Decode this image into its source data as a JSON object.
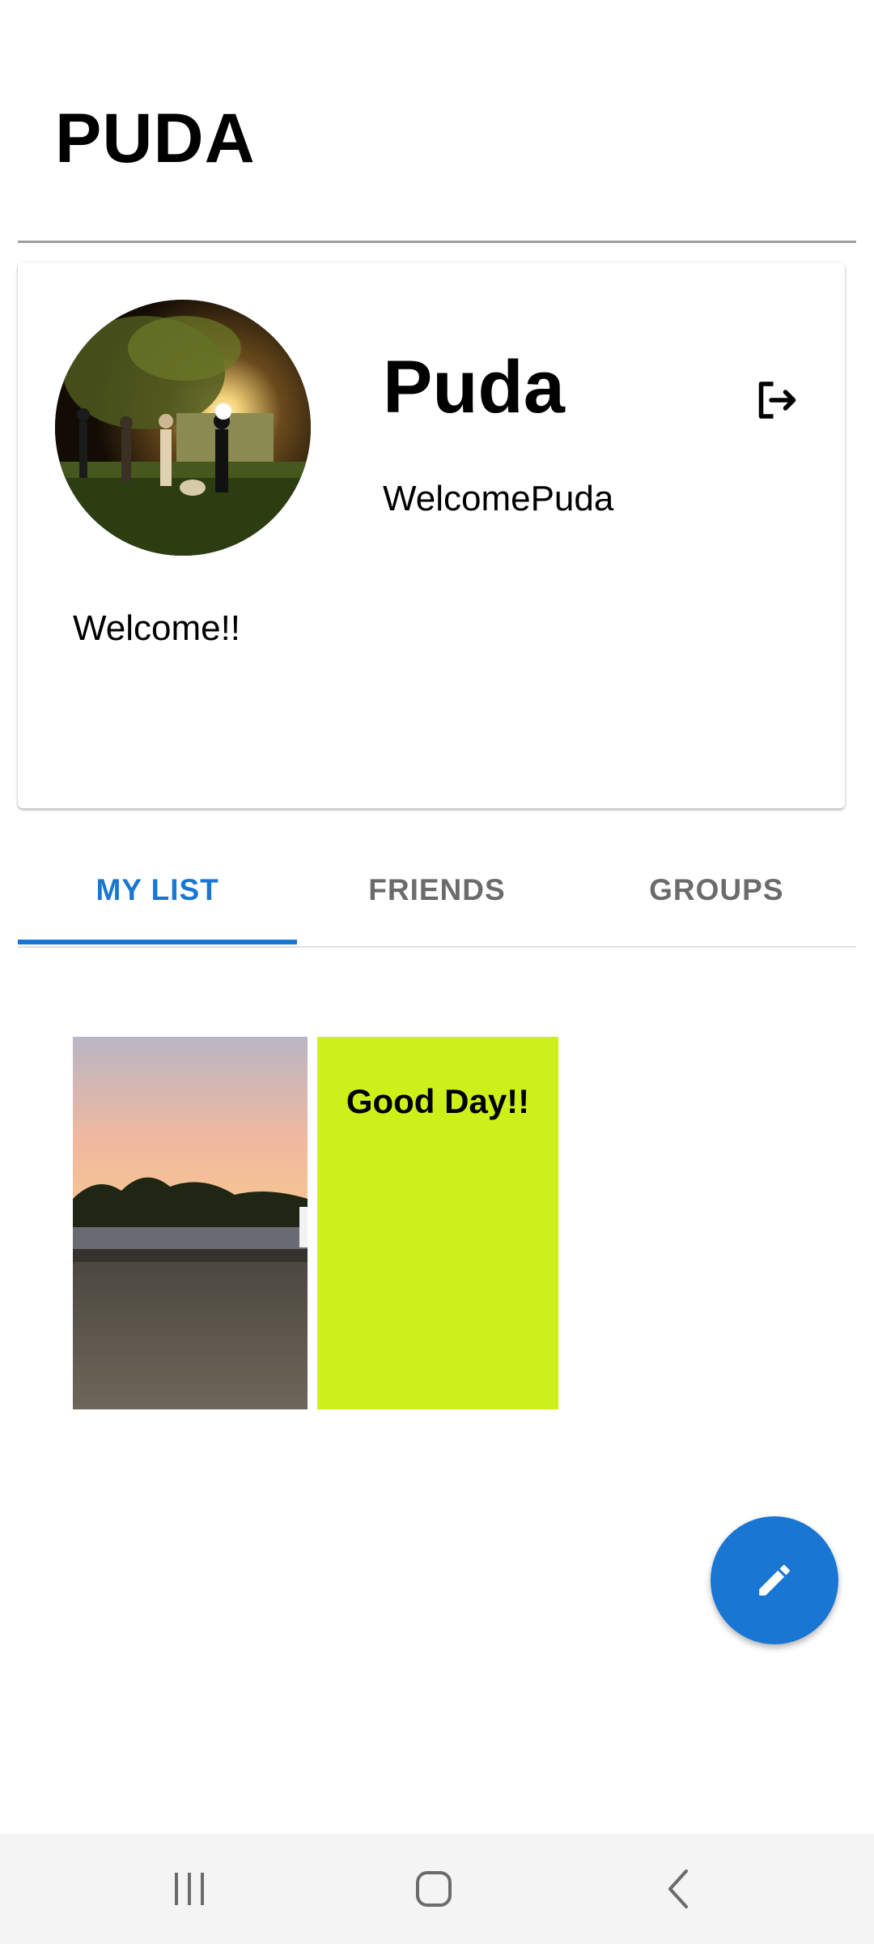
{
  "app": {
    "title": "PUDA"
  },
  "profile": {
    "name": "Puda",
    "username": "WelcomePuda",
    "bio": "Welcome!!",
    "avatar_icon": "avatar-photo",
    "logout_icon": "logout-icon"
  },
  "tabs": [
    {
      "label": "MY LIST",
      "active": true
    },
    {
      "label": "FRIENDS",
      "active": false
    },
    {
      "label": "GROUPS",
      "active": false
    }
  ],
  "posts": [
    {
      "type": "image",
      "description_icon": "sunset-beach-photo"
    },
    {
      "type": "text",
      "text": "Good Day!!",
      "background": "#cdf01a"
    }
  ],
  "fab": {
    "icon": "pencil-icon",
    "color": "#1976d2"
  },
  "colors": {
    "accent": "#1976d2",
    "text_post_bg": "#cdf01a"
  },
  "navigation": {
    "recent_icon": "recent-apps-icon",
    "home_icon": "home-icon",
    "back_icon": "back-icon"
  }
}
